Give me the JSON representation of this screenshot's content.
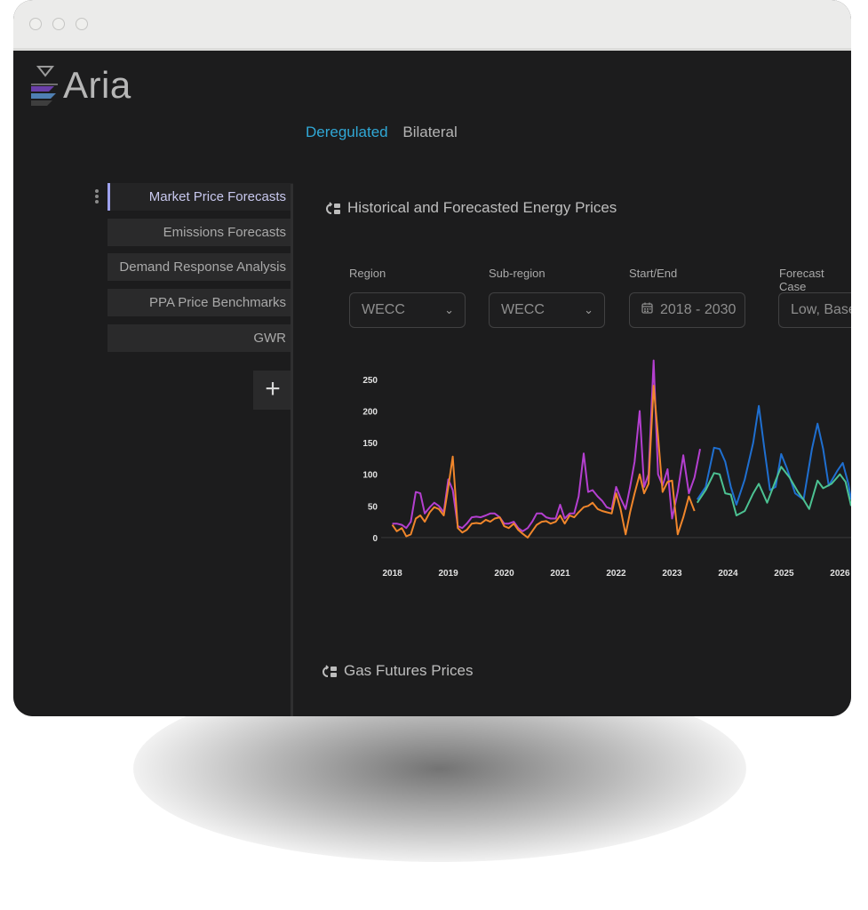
{
  "app": {
    "logo_text": "Aria"
  },
  "top_tabs": [
    {
      "label": "Deregulated",
      "active": true
    },
    {
      "label": "Bilateral",
      "active": false
    }
  ],
  "sidebar": {
    "items": [
      {
        "label": "Market Price Forecasts",
        "active": true
      },
      {
        "label": "Emissions Forecasts",
        "active": false
      },
      {
        "label": "Demand Response Analysis",
        "active": false
      },
      {
        "label": "PPA Price Benchmarks",
        "active": false
      },
      {
        "label": "GWR",
        "active": false
      }
    ],
    "add_label": "+"
  },
  "sections": {
    "energy_title": "Historical and Forecasted Energy Prices",
    "gas_title": "Gas Futures Prices"
  },
  "filters": {
    "region": {
      "label": "Region",
      "value": "WECC"
    },
    "subregion": {
      "label": "Sub-region",
      "value": "WECC"
    },
    "start_end": {
      "label": "Start/End",
      "value": "2018 - 2030"
    },
    "forecast_case": {
      "label": "Forecast Case",
      "value": "Low, Base,"
    }
  },
  "colors": {
    "accent": "#30a8d6",
    "sidebar_active": "#9ea2ee",
    "series_purple": "#b43fd0",
    "series_orange": "#f0862b",
    "series_blue": "#1f6fd0",
    "series_green": "#4cc292"
  },
  "chart_data": {
    "type": "line",
    "x_unit": "year",
    "xlim": [
      2017.8,
      2026.2
    ],
    "ylim": [
      -10,
      285
    ],
    "yticks": [
      0,
      50,
      100,
      150,
      200,
      250
    ],
    "xticks": [
      2018,
      2019,
      2020,
      2021,
      2022,
      2023,
      2024,
      2025,
      2026
    ],
    "grid": false,
    "legend": "none",
    "series": [
      {
        "color": "#b43fd0",
        "points": [
          [
            2018.0,
            22
          ],
          [
            2018.08,
            22
          ],
          [
            2018.17,
            20
          ],
          [
            2018.25,
            15
          ],
          [
            2018.33,
            25
          ],
          [
            2018.42,
            72
          ],
          [
            2018.5,
            70
          ],
          [
            2018.58,
            38
          ],
          [
            2018.67,
            48
          ],
          [
            2018.75,
            55
          ],
          [
            2018.83,
            50
          ],
          [
            2018.92,
            40
          ],
          [
            2019.0,
            92
          ],
          [
            2019.08,
            75
          ],
          [
            2019.17,
            18
          ],
          [
            2019.25,
            15
          ],
          [
            2019.33,
            22
          ],
          [
            2019.42,
            32
          ],
          [
            2019.5,
            33
          ],
          [
            2019.58,
            32
          ],
          [
            2019.67,
            35
          ],
          [
            2019.75,
            38
          ],
          [
            2019.83,
            38
          ],
          [
            2019.92,
            32
          ],
          [
            2020.0,
            22
          ],
          [
            2020.08,
            22
          ],
          [
            2020.17,
            25
          ],
          [
            2020.25,
            15
          ],
          [
            2020.33,
            10
          ],
          [
            2020.42,
            15
          ],
          [
            2020.5,
            25
          ],
          [
            2020.58,
            38
          ],
          [
            2020.67,
            38
          ],
          [
            2020.75,
            32
          ],
          [
            2020.83,
            30
          ],
          [
            2020.92,
            30
          ],
          [
            2021.0,
            52
          ],
          [
            2021.08,
            30
          ],
          [
            2021.17,
            38
          ],
          [
            2021.25,
            38
          ],
          [
            2021.33,
            65
          ],
          [
            2021.42,
            133
          ],
          [
            2021.5,
            72
          ],
          [
            2021.58,
            75
          ],
          [
            2021.67,
            65
          ],
          [
            2021.75,
            58
          ],
          [
            2021.83,
            48
          ],
          [
            2021.92,
            45
          ],
          [
            2022.0,
            80
          ],
          [
            2022.08,
            62
          ],
          [
            2022.17,
            45
          ],
          [
            2022.25,
            80
          ],
          [
            2022.33,
            120
          ],
          [
            2022.42,
            200
          ],
          [
            2022.5,
            80
          ],
          [
            2022.58,
            100
          ],
          [
            2022.67,
            280
          ],
          [
            2022.75,
            100
          ],
          [
            2022.83,
            82
          ],
          [
            2022.92,
            108
          ],
          [
            2023.0,
            30
          ],
          [
            2023.1,
            72
          ],
          [
            2023.2,
            130
          ],
          [
            2023.3,
            70
          ],
          [
            2023.4,
            95
          ],
          [
            2023.5,
            140
          ]
        ]
      },
      {
        "color": "#f0862b",
        "points": [
          [
            2018.0,
            20
          ],
          [
            2018.08,
            10
          ],
          [
            2018.17,
            15
          ],
          [
            2018.25,
            2
          ],
          [
            2018.33,
            5
          ],
          [
            2018.42,
            30
          ],
          [
            2018.5,
            35
          ],
          [
            2018.58,
            25
          ],
          [
            2018.67,
            40
          ],
          [
            2018.75,
            48
          ],
          [
            2018.83,
            45
          ],
          [
            2018.92,
            35
          ],
          [
            2019.0,
            80
          ],
          [
            2019.08,
            128
          ],
          [
            2019.17,
            15
          ],
          [
            2019.25,
            8
          ],
          [
            2019.33,
            12
          ],
          [
            2019.42,
            22
          ],
          [
            2019.5,
            23
          ],
          [
            2019.58,
            22
          ],
          [
            2019.67,
            28
          ],
          [
            2019.75,
            25
          ],
          [
            2019.83,
            30
          ],
          [
            2019.92,
            32
          ],
          [
            2020.0,
            18
          ],
          [
            2020.08,
            15
          ],
          [
            2020.17,
            22
          ],
          [
            2020.25,
            12
          ],
          [
            2020.33,
            6
          ],
          [
            2020.42,
            0
          ],
          [
            2020.5,
            10
          ],
          [
            2020.58,
            20
          ],
          [
            2020.67,
            25
          ],
          [
            2020.75,
            26
          ],
          [
            2020.83,
            22
          ],
          [
            2020.92,
            25
          ],
          [
            2021.0,
            35
          ],
          [
            2021.08,
            22
          ],
          [
            2021.17,
            35
          ],
          [
            2021.25,
            32
          ],
          [
            2021.33,
            40
          ],
          [
            2021.42,
            48
          ],
          [
            2021.5,
            50
          ],
          [
            2021.58,
            55
          ],
          [
            2021.67,
            45
          ],
          [
            2021.75,
            42
          ],
          [
            2021.83,
            40
          ],
          [
            2021.92,
            38
          ],
          [
            2022.0,
            70
          ],
          [
            2022.08,
            45
          ],
          [
            2022.17,
            5
          ],
          [
            2022.25,
            40
          ],
          [
            2022.33,
            70
          ],
          [
            2022.42,
            100
          ],
          [
            2022.5,
            70
          ],
          [
            2022.58,
            85
          ],
          [
            2022.67,
            240
          ],
          [
            2022.75,
            160
          ],
          [
            2022.83,
            72
          ],
          [
            2022.92,
            88
          ],
          [
            2023.0,
            90
          ],
          [
            2023.1,
            5
          ],
          [
            2023.2,
            32
          ],
          [
            2023.3,
            65
          ],
          [
            2023.4,
            42
          ]
        ]
      },
      {
        "color": "#1f6fd0",
        "points": [
          [
            2023.45,
            60
          ],
          [
            2023.6,
            80
          ],
          [
            2023.75,
            142
          ],
          [
            2023.85,
            140
          ],
          [
            2023.95,
            120
          ],
          [
            2024.05,
            80
          ],
          [
            2024.15,
            52
          ],
          [
            2024.3,
            92
          ],
          [
            2024.45,
            150
          ],
          [
            2024.55,
            208
          ],
          [
            2024.65,
            140
          ],
          [
            2024.75,
            75
          ],
          [
            2024.85,
            80
          ],
          [
            2024.95,
            132
          ],
          [
            2025.05,
            110
          ],
          [
            2025.2,
            70
          ],
          [
            2025.35,
            60
          ],
          [
            2025.5,
            140
          ],
          [
            2025.6,
            180
          ],
          [
            2025.7,
            140
          ],
          [
            2025.8,
            82
          ],
          [
            2025.95,
            105
          ],
          [
            2026.05,
            118
          ],
          [
            2026.15,
            85
          ],
          [
            2026.2,
            60
          ]
        ]
      },
      {
        "color": "#4cc292",
        "points": [
          [
            2023.45,
            55
          ],
          [
            2023.6,
            75
          ],
          [
            2023.75,
            102
          ],
          [
            2023.85,
            100
          ],
          [
            2023.95,
            70
          ],
          [
            2024.05,
            68
          ],
          [
            2024.15,
            35
          ],
          [
            2024.3,
            42
          ],
          [
            2024.45,
            70
          ],
          [
            2024.55,
            85
          ],
          [
            2024.7,
            55
          ],
          [
            2024.85,
            90
          ],
          [
            2024.95,
            112
          ],
          [
            2025.1,
            95
          ],
          [
            2025.25,
            72
          ],
          [
            2025.35,
            60
          ],
          [
            2025.45,
            45
          ],
          [
            2025.6,
            90
          ],
          [
            2025.7,
            78
          ],
          [
            2025.85,
            85
          ],
          [
            2026.0,
            100
          ],
          [
            2026.1,
            88
          ],
          [
            2026.2,
            50
          ]
        ]
      }
    ]
  }
}
